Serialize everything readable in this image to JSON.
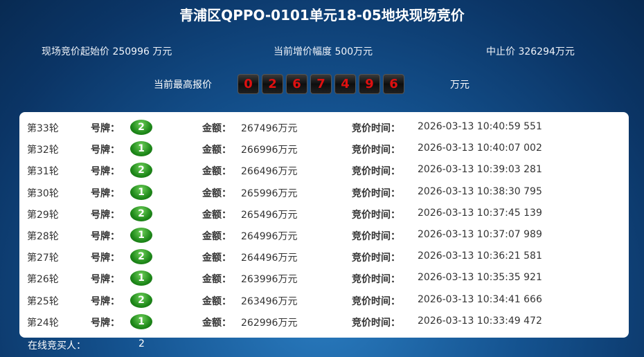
{
  "title": "青浦区QPPO-0101单元18-05地块现场竞价",
  "info": {
    "start_price": "现场竞价起始价 250996 万元",
    "increment": "当前增价幅度 500万元",
    "stop_price": "中止价 326294万元"
  },
  "highest": {
    "label": "当前最高报价",
    "digits": [
      "0",
      "2",
      "6",
      "7",
      "4",
      "9",
      "6"
    ],
    "unit": "万元"
  },
  "labels": {
    "plate": "号牌：",
    "amount": "金额：",
    "time": "竞价时间："
  },
  "rows": [
    {
      "round": "第33轮",
      "plate": "2",
      "amount": "267496万元",
      "time": "2026-03-13 10:40:59 551"
    },
    {
      "round": "第32轮",
      "plate": "1",
      "amount": "266996万元",
      "time": "2026-03-13 10:40:07 002"
    },
    {
      "round": "第31轮",
      "plate": "2",
      "amount": "266496万元",
      "time": "2026-03-13 10:39:03 281"
    },
    {
      "round": "第30轮",
      "plate": "1",
      "amount": "265996万元",
      "time": "2026-03-13 10:38:30 795"
    },
    {
      "round": "第29轮",
      "plate": "2",
      "amount": "265496万元",
      "time": "2026-03-13 10:37:45 139"
    },
    {
      "round": "第28轮",
      "plate": "1",
      "amount": "264996万元",
      "time": "2026-03-13 10:37:07 989"
    },
    {
      "round": "第27轮",
      "plate": "2",
      "amount": "264496万元",
      "time": "2026-03-13 10:36:21 581"
    },
    {
      "round": "第26轮",
      "plate": "1",
      "amount": "263996万元",
      "time": "2026-03-13 10:35:35 921"
    },
    {
      "round": "第25轮",
      "plate": "2",
      "amount": "263496万元",
      "time": "2026-03-13 10:34:41 666"
    },
    {
      "round": "第24轮",
      "plate": "1",
      "amount": "262996万元",
      "time": "2026-03-13 10:33:49 472"
    }
  ],
  "footer": {
    "label": "在线竞买人：",
    "value": "2"
  }
}
